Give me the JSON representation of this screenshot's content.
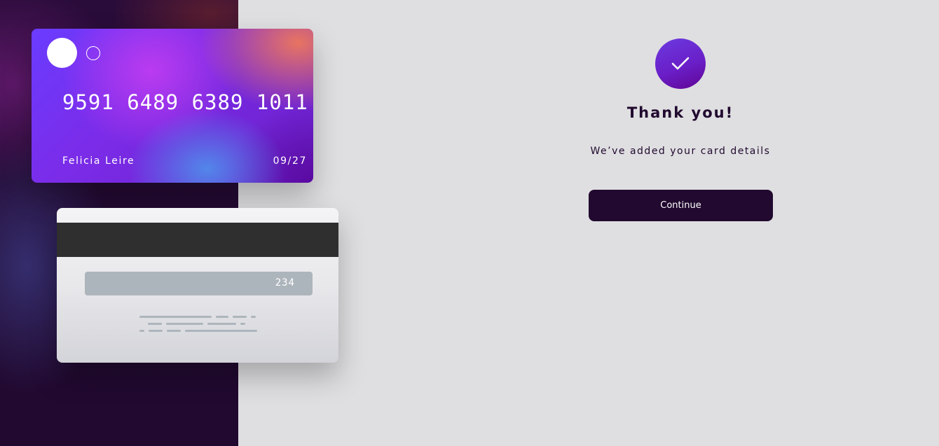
{
  "card_front": {
    "number": "9591 6489 6389 1011",
    "holder_name": "Felicia Leire",
    "expiry": "09/27"
  },
  "card_back": {
    "cvc": "234"
  },
  "confirmation": {
    "icon": "check-icon",
    "title": "Thank you!",
    "message": "We’ve added your card details",
    "continue_label": "Continue"
  },
  "colors": {
    "dark_violet": "#21092f",
    "page_background": "#dfdfe1",
    "accent_gradient_start": "#6c3ae0",
    "accent_gradient_end": "#610595",
    "cvc_strip": "#adb5bc"
  }
}
